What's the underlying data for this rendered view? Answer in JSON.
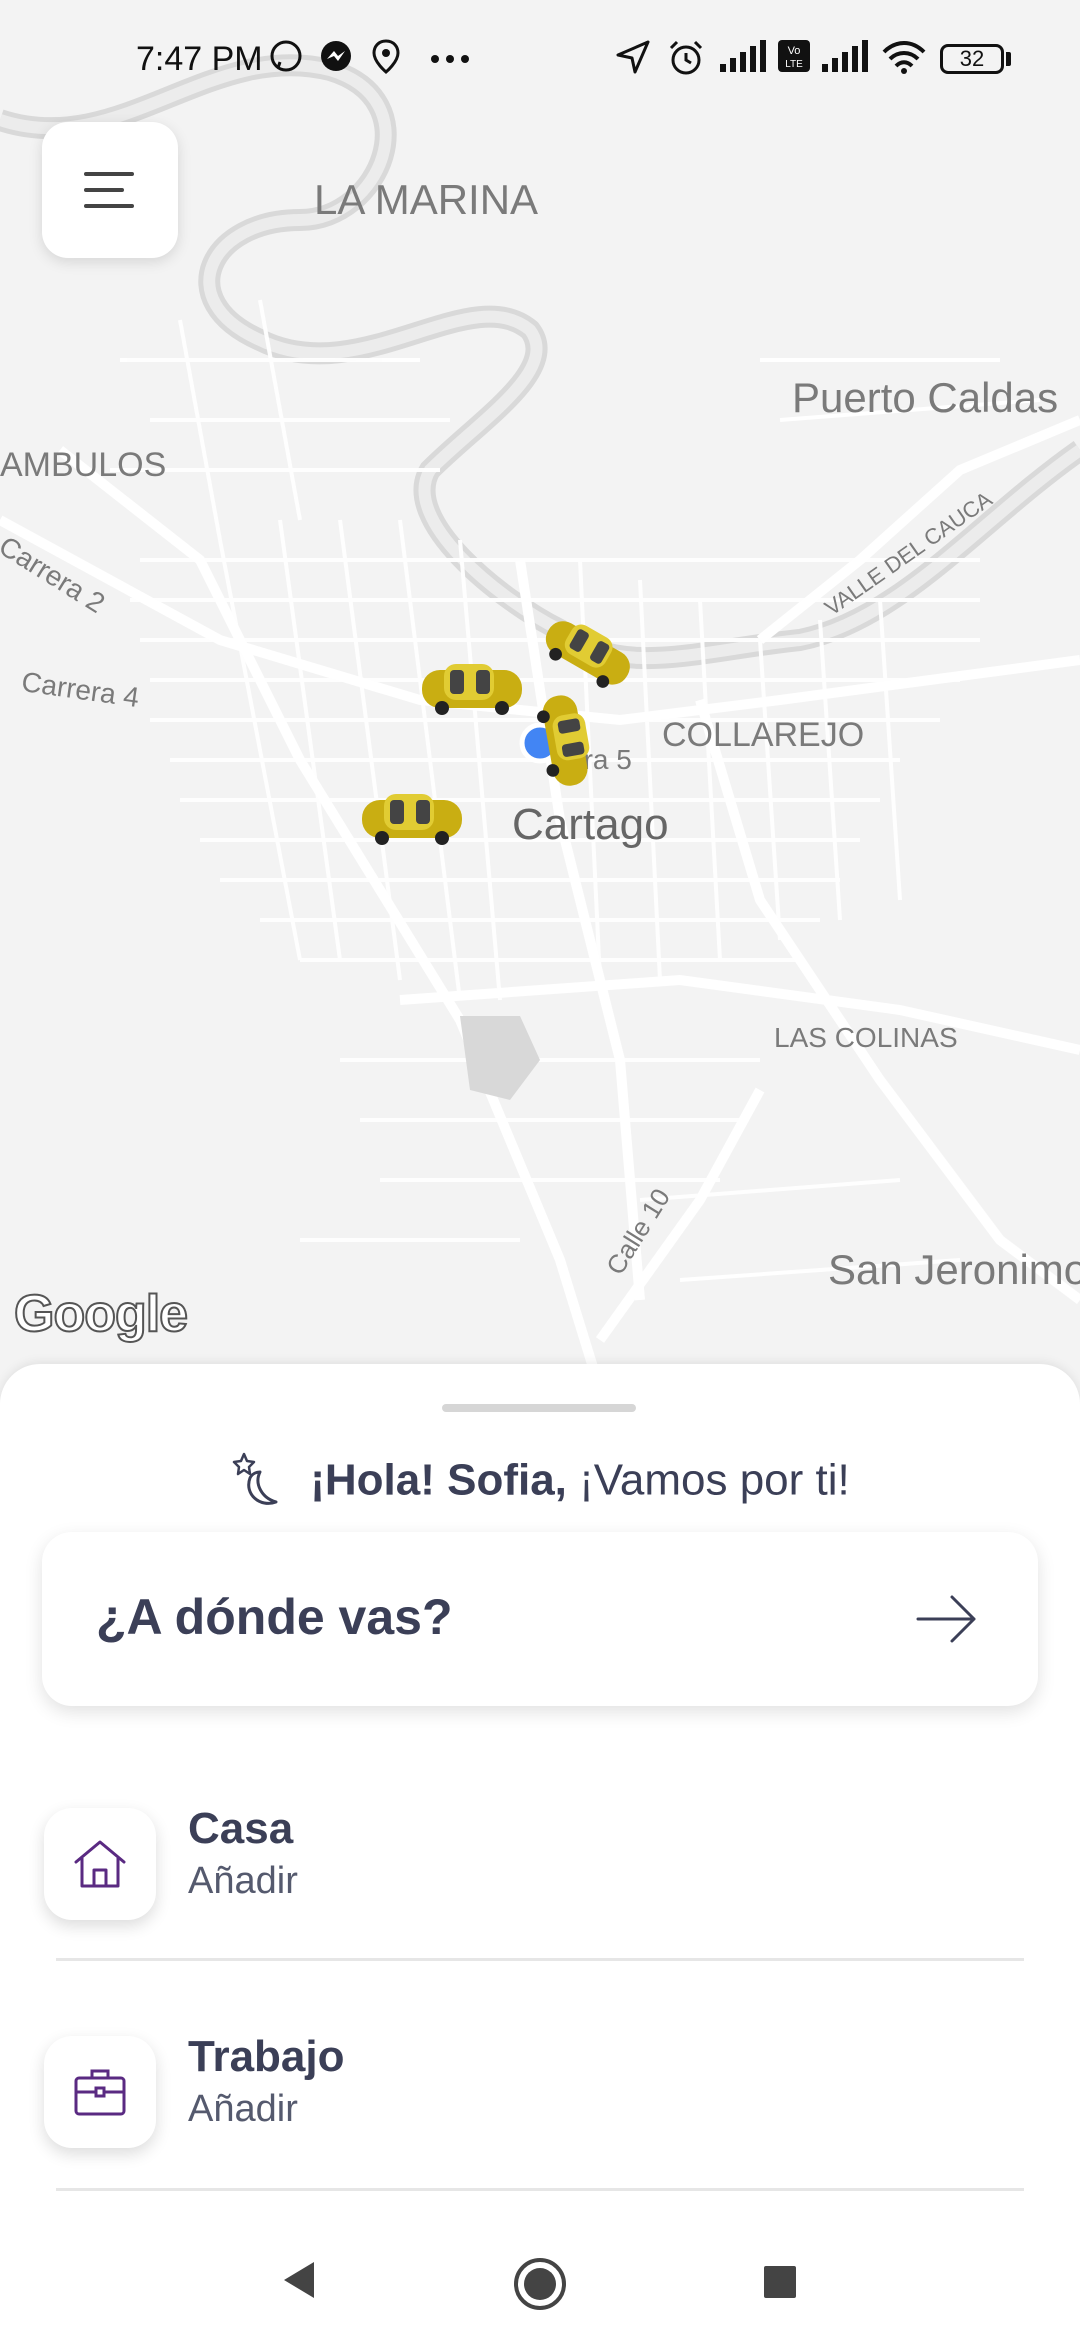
{
  "status_bar": {
    "time": "7:47 PM",
    "battery": "32",
    "icons": [
      "whatsapp-icon",
      "messenger-icon",
      "location-pin-icon",
      "more-icon",
      "navigation-icon",
      "alarm-icon",
      "signal-icon",
      "volte-icon",
      "signal-icon",
      "wifi-icon",
      "battery-icon"
    ]
  },
  "map": {
    "labels": {
      "la_marina": "LA MARINA",
      "puerto_caldas": "Puerto Caldas",
      "ambulos": "AMBULOS",
      "carrera_2": "Carrera 2",
      "carrera_4": "Carrera 4",
      "valle_del_cauca": "VALLE DEL CAUCA",
      "collarejo": "COLLAREJO",
      "carrera_5": "era 5",
      "cartago": "Cartago",
      "las_colinas": "LAS COLINAS",
      "calle_10": "Calle 10",
      "san_jeronimo": "San Jeronimo"
    },
    "attribution": "Google",
    "taxi_icon": "taxi-car-icon",
    "accent_location": "#4285f4",
    "taxi_color": "#d4bd1a"
  },
  "sheet": {
    "greeting_name": "¡Hola! Sofia,",
    "greeting_rest": " ¡Vamos por ti!",
    "destination_placeholder": "¿A dónde vas?",
    "places": [
      {
        "title": "Casa",
        "subtitle": "Añadir",
        "icon": "home-icon"
      },
      {
        "title": "Trabajo",
        "subtitle": "Añadir",
        "icon": "briefcase-icon"
      }
    ],
    "accent_color": "#5a2a82",
    "text_color": "#3b3f57"
  }
}
